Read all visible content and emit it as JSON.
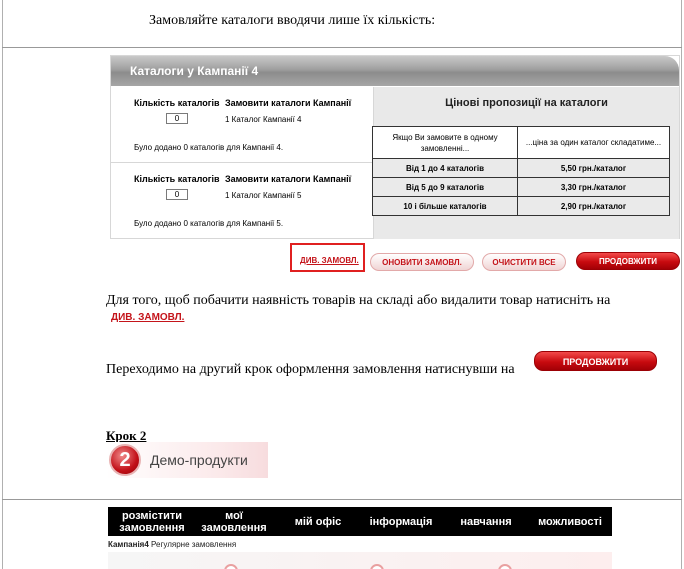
{
  "intro_text": "Замовляйте каталоги вводячи лише їх кількість:",
  "widget": {
    "header_title": "Каталоги у Кампанії 4",
    "campaigns": [
      {
        "qty_header": "Кількість каталогів",
        "order_header": "Замовити каталоги Кампанії",
        "qty_value": "0",
        "catalog_name": "1 Каталог Кампанії 4",
        "note": "Було додано 0 каталогів для Кампанії 4."
      },
      {
        "qty_header": "Кількість каталогів",
        "order_header": "Замовити каталоги Кампанії",
        "qty_value": "0",
        "catalog_name": "1 Каталог Кампанії 5",
        "note": "Було додано 0 каталогів для Кампанії 5."
      }
    ],
    "price_title": "Цінові пропозиції на каталоги",
    "price_table": {
      "head": [
        "Якщо Ви замовите в одному замовленні...",
        "...ціна за один каталог складатиме..."
      ],
      "rows": [
        [
          "Від 1 до 4 каталогів",
          "5,50 грн./каталог"
        ],
        [
          "Від 5 до 9 каталогів",
          "3,30 грн./каталог"
        ],
        [
          "10 і більше каталогів",
          "2,90 грн./каталог"
        ]
      ]
    }
  },
  "buttons": {
    "view_order": "ДИВ. ЗАМОВЛ.",
    "update_order": "ОНОВИТИ ЗАМОВЛ.",
    "clear_all": "ОЧИСТИТИ ВСЕ",
    "continue": "ПРОДОВЖИТИ"
  },
  "paragraph1": "Для того, щоб побачити наявність товарів на складі або видалити товар натисніть на",
  "paragraph1_link": "ДИВ. ЗАМОВЛ.",
  "paragraph2": "Переходимо на другий крок оформлення замовлення натиснувши на",
  "paragraph2_button": "ПРОДОВЖИТИ",
  "step_title": "Крок 2",
  "demo_banner": {
    "number": "2",
    "label": "Демо-продукти"
  },
  "nav": [
    "розмістити замовлення",
    "мої замовлення",
    "мій офіс",
    "інформація",
    "навчання",
    "можливості"
  ],
  "breadcrumb": {
    "campaign": "Кампанія4",
    "type": "Регулярне замовлення"
  },
  "colors": {
    "brand_red": "#c4141a",
    "nav_bg": "#000000"
  }
}
